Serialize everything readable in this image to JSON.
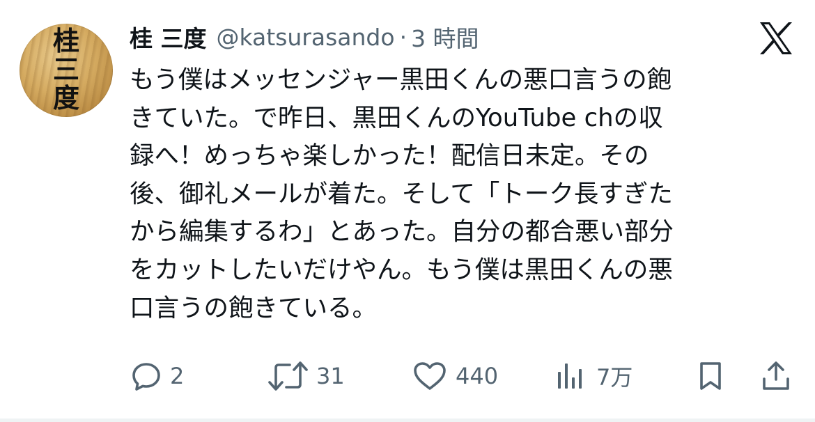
{
  "tweet": {
    "author_name": "桂 三度",
    "handle": "@katsurasando",
    "separator": "·",
    "time": "3 時間",
    "avatar_text": [
      "桂",
      "三",
      "度"
    ],
    "body_lines": [
      "もう僕はメッセンジャー黒田くんの悪口言うの飽",
      "きていた。で昨日、黒田くんのYouTube chの収",
      "録へ！めっちゃ楽しかった！配信日未定。その",
      "後、御礼メールが着た。そして「トーク長すぎた",
      "から編集するわ」とあった。自分の都合悪い部分",
      "をカットしたいだけやん。もう僕は黒田くんの悪",
      "口言うの飽きている。"
    ]
  },
  "actions": {
    "reply_count": "2",
    "retweet_count": "31",
    "like_count": "440",
    "views_count": "7万"
  },
  "icons": {
    "brand": "x-logo-icon",
    "reply": "reply-icon",
    "retweet": "retweet-icon",
    "like": "heart-icon",
    "views": "views-bar-chart-icon",
    "bookmark": "bookmark-icon",
    "share": "share-icon"
  },
  "colors": {
    "text_primary": "#0f1419",
    "text_secondary": "#536471",
    "background": "#ffffff"
  }
}
